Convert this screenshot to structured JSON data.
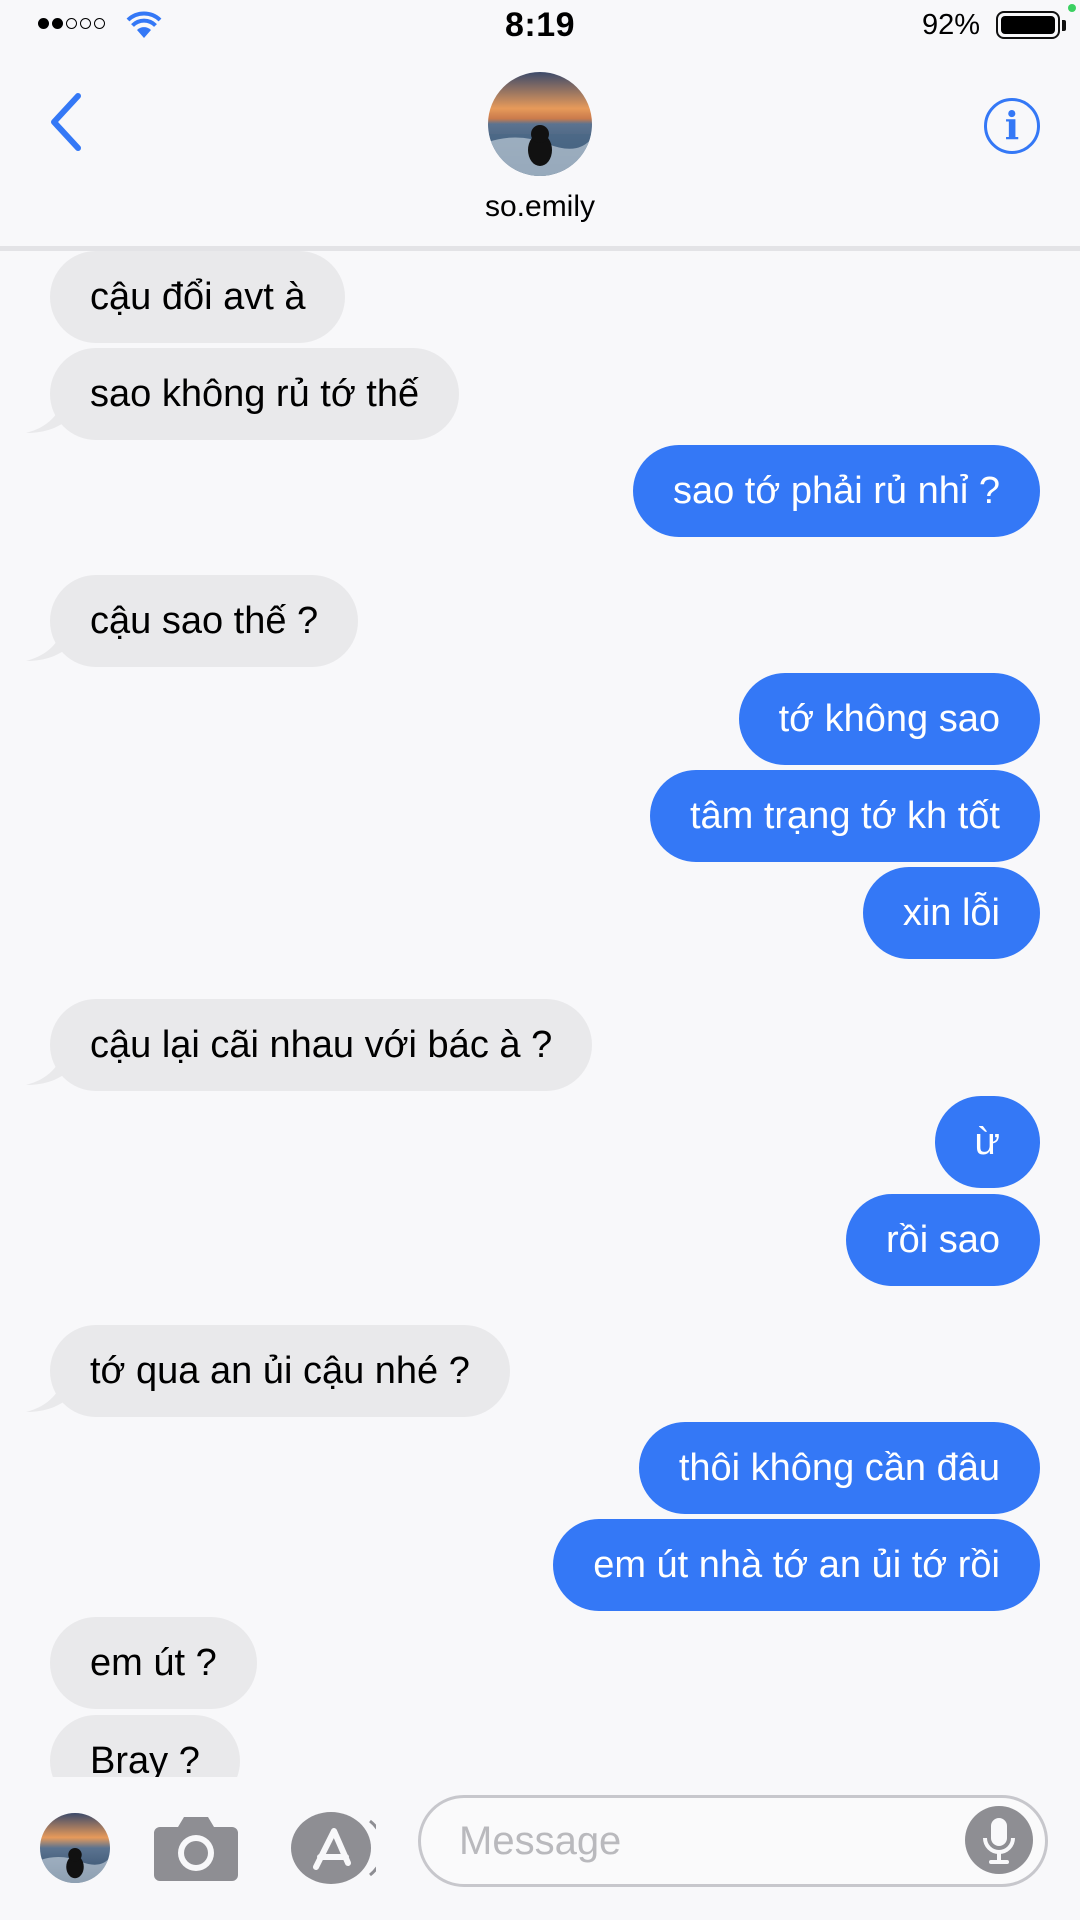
{
  "status_bar": {
    "time": "8:19",
    "battery_percent": "92%",
    "signal_bars": 2,
    "signal_total": 5,
    "battery_level": 0.92
  },
  "header": {
    "contact_name": "so.emily",
    "info_glyph": "i"
  },
  "messages": [
    {
      "direction": "in",
      "text": "cậu đổi avt à"
    },
    {
      "direction": "in",
      "text": "sao không rủ tớ thế"
    },
    {
      "direction": "out",
      "text": "sao tớ phải rủ nhỉ ?"
    },
    {
      "direction": "in",
      "text": "cậu sao thế ?"
    },
    {
      "direction": "out",
      "text": "tớ không sao"
    },
    {
      "direction": "out",
      "text": "tâm trạng tớ kh tốt"
    },
    {
      "direction": "out",
      "text": "xin lỗi"
    },
    {
      "direction": "in",
      "text": "cậu lại cãi nhau với bác à ?"
    },
    {
      "direction": "out",
      "text": "ừ"
    },
    {
      "direction": "out",
      "text": "rồi sao"
    },
    {
      "direction": "in",
      "text": "tớ qua an ủi cậu nhé ?"
    },
    {
      "direction": "out",
      "text": "thôi không cần đâu"
    },
    {
      "direction": "out",
      "text": "em út nhà tớ an ủi tớ rồi"
    },
    {
      "direction": "in",
      "text": "em út ?"
    },
    {
      "direction": "in",
      "text": "Bray ?"
    }
  ],
  "composer": {
    "placeholder": "Message"
  },
  "icons": {
    "back": "chevron-left-icon",
    "info": "info-icon",
    "camera": "camera-icon",
    "appstore": "app-store-icon",
    "mic": "microphone-icon",
    "wifi": "wifi-icon",
    "battery": "battery-icon"
  },
  "colors": {
    "accent": "#3478f6",
    "incoming_bubble": "#e9e9eb",
    "outgoing_bubble": "#3478f6",
    "background": "#f8f8fa"
  }
}
